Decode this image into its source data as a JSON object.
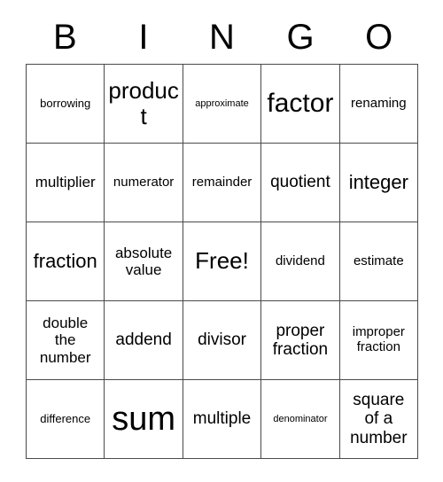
{
  "card": {
    "header_letters": [
      "B",
      "I",
      "N",
      "G",
      "O"
    ],
    "border_color": "#4a4a4a",
    "background_color": "#ffffff",
    "text_color": "#000000",
    "rows": [
      [
        {
          "text": "borrowing",
          "size": "sz-s"
        },
        {
          "text": "product",
          "size": "sz-xxl"
        },
        {
          "text": "approximate",
          "size": "sz-xs"
        },
        {
          "text": "factor",
          "size": "sz-huge"
        },
        {
          "text": "renaming",
          "size": "sz-m"
        }
      ],
      [
        {
          "text": "multiplier",
          "size": "sz-ml"
        },
        {
          "text": "numerator",
          "size": "sz-m"
        },
        {
          "text": "remainder",
          "size": "sz-m"
        },
        {
          "text": "quotient",
          "size": "sz-l"
        },
        {
          "text": "integer",
          "size": "sz-xl"
        }
      ],
      [
        {
          "text": "fraction",
          "size": "sz-xl"
        },
        {
          "text": "absolute\nvalue",
          "size": "sz-ml"
        },
        {
          "text": "Free!",
          "size": "sz-xxl"
        },
        {
          "text": "dividend",
          "size": "sz-m"
        },
        {
          "text": "estimate",
          "size": "sz-m"
        }
      ],
      [
        {
          "text": "double\nthe\nnumber",
          "size": "sz-ml"
        },
        {
          "text": "addend",
          "size": "sz-l"
        },
        {
          "text": "divisor",
          "size": "sz-l"
        },
        {
          "text": "proper\nfraction",
          "size": "sz-l"
        },
        {
          "text": "improper\nfraction",
          "size": "sz-m"
        }
      ],
      [
        {
          "text": "difference",
          "size": "sz-s"
        },
        {
          "text": "sum",
          "size": "sz-mega"
        },
        {
          "text": "multiple",
          "size": "sz-l"
        },
        {
          "text": "denominator",
          "size": "sz-xs"
        },
        {
          "text": "square\nof a\nnumber",
          "size": "sz-l"
        }
      ]
    ]
  }
}
